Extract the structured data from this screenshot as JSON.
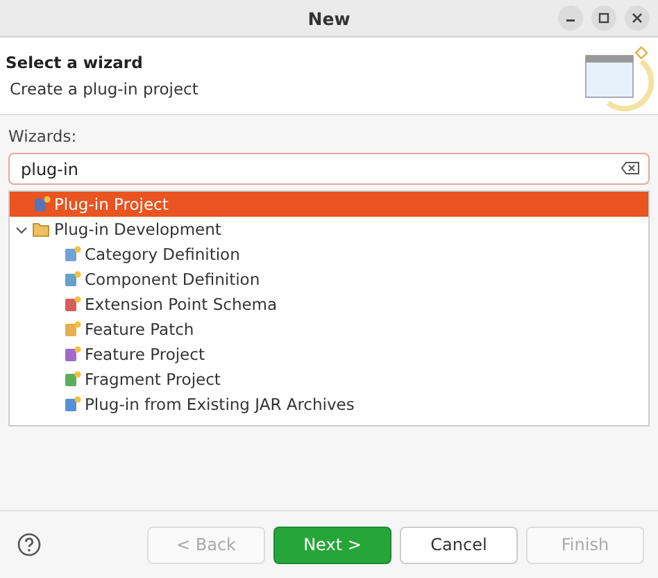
{
  "window": {
    "title": "New"
  },
  "header": {
    "title": "Select a wizard",
    "description": "Create a plug-in project"
  },
  "filter": {
    "label": "Wizards:",
    "value": "plug-in"
  },
  "tree": [
    {
      "label": "Plug-in Project",
      "selected": true
    },
    {
      "label": "Plug-in Development",
      "selected": false,
      "expanded": true,
      "children": [
        {
          "label": "Category Definition",
          "selected": false
        },
        {
          "label": "Component Definition",
          "selected": false
        },
        {
          "label": "Extension Point Schema",
          "selected": false
        },
        {
          "label": "Feature Patch",
          "selected": false
        },
        {
          "label": "Feature Project",
          "selected": false
        },
        {
          "label": "Fragment Project",
          "selected": false
        },
        {
          "label": "Plug-in from Existing JAR Archives",
          "selected": false
        }
      ]
    }
  ],
  "buttons": [
    {
      "label": "< Back",
      "kind": "normal",
      "disabled": true
    },
    {
      "label": "Next >",
      "kind": "default",
      "disabled": false
    },
    {
      "label": "Cancel",
      "kind": "normal",
      "disabled": false
    },
    {
      "label": "Finish",
      "kind": "normal",
      "disabled": true
    }
  ]
}
